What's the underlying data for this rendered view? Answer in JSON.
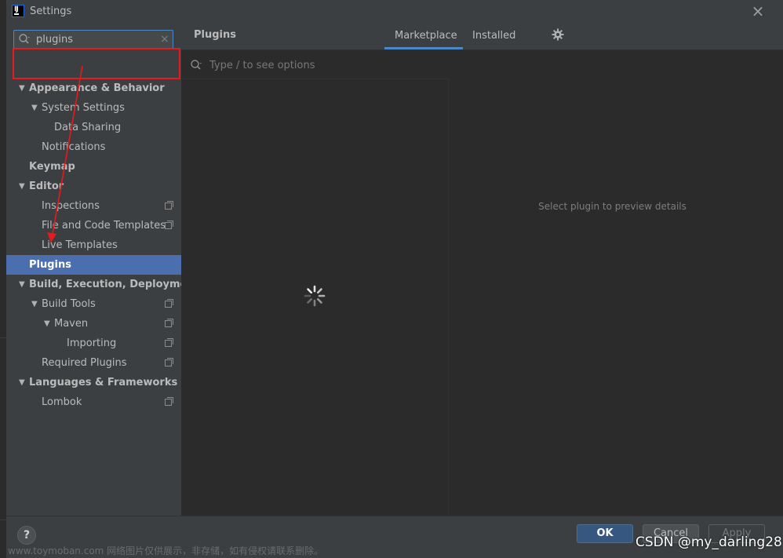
{
  "window": {
    "title": "Settings",
    "close_glyph": "×"
  },
  "sidebar": {
    "search": {
      "value": "plugins",
      "clear_glyph": "×"
    },
    "items": [
      {
        "label": "Appearance & Behavior",
        "level": 0,
        "expanded": true,
        "bold": true
      },
      {
        "label": "System Settings",
        "level": 1,
        "expanded": true
      },
      {
        "label": "Data Sharing",
        "level": 2
      },
      {
        "label": "Notifications",
        "level": 1
      },
      {
        "label": "Keymap",
        "level": 0,
        "bold": true
      },
      {
        "label": "Editor",
        "level": 0,
        "expanded": true,
        "bold": true
      },
      {
        "label": "Inspections",
        "level": 1,
        "badge": true
      },
      {
        "label": "File and Code Templates",
        "level": 1,
        "badge": true
      },
      {
        "label": "Live Templates",
        "level": 1
      },
      {
        "label": "Plugins",
        "level": 0,
        "selected": true,
        "bold": true
      },
      {
        "label": "Build, Execution, Deployment",
        "level": 0,
        "expanded": true,
        "bold": true
      },
      {
        "label": "Build Tools",
        "level": 1,
        "expanded": true,
        "badge": true
      },
      {
        "label": "Maven",
        "level": 2,
        "expanded": true,
        "badge": true
      },
      {
        "label": "Importing",
        "level": 3,
        "badge": true
      },
      {
        "label": "Required Plugins",
        "level": 1,
        "badge": true
      },
      {
        "label": "Languages & Frameworks",
        "level": 0,
        "expanded": true,
        "bold": true
      },
      {
        "label": "Lombok",
        "level": 1,
        "badge": true
      }
    ]
  },
  "main": {
    "title": "Plugins",
    "tabs": [
      {
        "label": "Marketplace",
        "active": true
      },
      {
        "label": "Installed",
        "active": false
      }
    ],
    "filter_placeholder": "Type / to see options",
    "preview_message": "Select plugin to preview details"
  },
  "footer": {
    "help_label": "?",
    "ok_label": "OK",
    "cancel_label": "Cancel",
    "apply_label": "Apply"
  },
  "watermarks": {
    "left": "www.toymoban.com 网络图片仅供展示，非存储，如有侵权请联系删除。",
    "right": "CSDN @my_darling28"
  },
  "colors": {
    "selected_row": "#4b6eaf",
    "accent": "#4a88c7",
    "annotation_red": "#e8191f",
    "ok_button": "#365880"
  }
}
